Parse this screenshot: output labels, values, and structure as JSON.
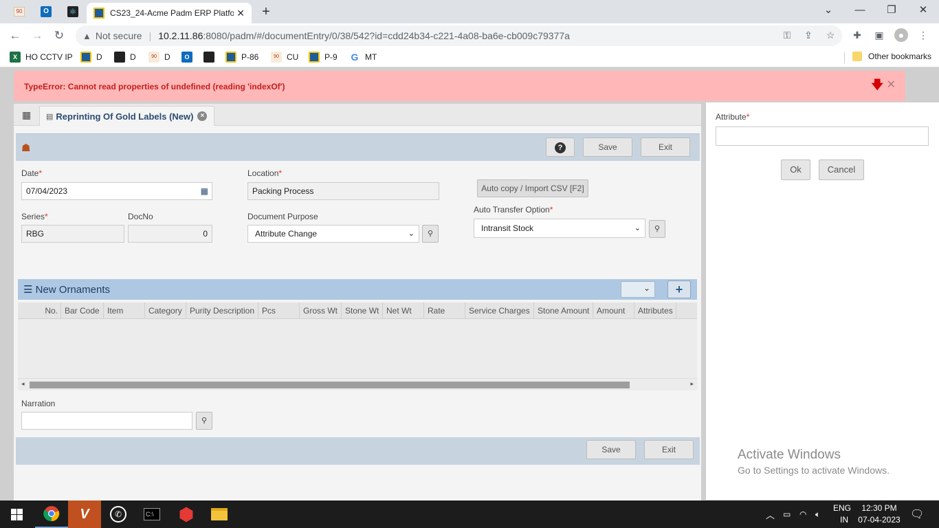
{
  "browser": {
    "tab_title": "CS23_24-Acme Padm ERP Platform",
    "url_warning": "Not secure",
    "url_host": "10.2.11.86",
    "url_path": ":8080/padm/#/documentEntry/0/38/542?id=cdd24b34-c221-4a08-ba6e-cb009c79377a",
    "bookmarks": [
      {
        "label": "HO CCTV IP",
        "color": "#1e7145"
      },
      {
        "label": "D",
        "color": "#1e5c9b"
      },
      {
        "label": "D",
        "color": "#222222"
      },
      {
        "label": "D",
        "color": "#e67e22"
      },
      {
        "label": "",
        "color": "#0f6cbd"
      },
      {
        "label": "",
        "color": "#222222"
      },
      {
        "label": "P-86",
        "color": "#1e5c9b"
      },
      {
        "label": "CU",
        "color": "#e67e22"
      },
      {
        "label": "P-9",
        "color": "#1e5c9b"
      },
      {
        "label": "MT",
        "color": "#4285f4"
      }
    ],
    "other_bookmarks": "Other bookmarks"
  },
  "error": {
    "message": "TypeError: Cannot read properties of undefined (reading 'indexOf')"
  },
  "doc": {
    "tab_label": "Reprinting Of Gold Labels (New)",
    "save_label": "Save",
    "exit_label": "Exit",
    "help_label": "?",
    "fields": {
      "date_label": "Date",
      "date_value": "07/04/2023",
      "location_label": "Location",
      "location_value": "Packing Process",
      "autocopy_label": "Auto copy / Import CSV [F2]",
      "auto_transfer_label": "Auto Transfer Option",
      "auto_transfer_value": "Intransit Stock",
      "series_label": "Series",
      "series_value": "RBG",
      "docno_label": "DocNo",
      "docno_value": "0",
      "purpose_label": "Document Purpose",
      "purpose_value": "Attribute Change",
      "narration_label": "Narration",
      "narration_value": ""
    },
    "ornaments": {
      "title": "New Ornaments",
      "columns": [
        "No.",
        "Bar Code",
        "Item",
        "Category",
        "Purity Description",
        "Pcs",
        "Gross Wt",
        "Stone Wt",
        "Net Wt",
        "Rate",
        "Service Charges",
        "Stone Amount",
        "Amount",
        "Attributes"
      ]
    }
  },
  "popup": {
    "attribute_label": "Attribute",
    "attribute_value": "",
    "ok_label": "Ok",
    "cancel_label": "Cancel"
  },
  "watermark": {
    "line1": "Activate Windows",
    "line2": "Go to Settings to activate Windows."
  },
  "taskbar": {
    "lang_top": "ENG",
    "lang_bottom": "IN",
    "time": "12:30 PM",
    "date": "07-04-2023"
  }
}
